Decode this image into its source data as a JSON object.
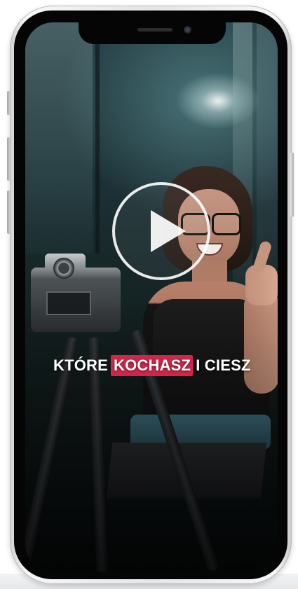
{
  "video": {
    "caption_part_1": "KTÓRE",
    "caption_highlight": "KOCHASZ",
    "caption_part_2": "I CIESZ",
    "highlight_color": "#d1264b",
    "caption_color": "#ffffff",
    "play_icon": "play-icon"
  },
  "device": {
    "frame_color": "#e4e5e7",
    "bezel_color": "#050505"
  }
}
